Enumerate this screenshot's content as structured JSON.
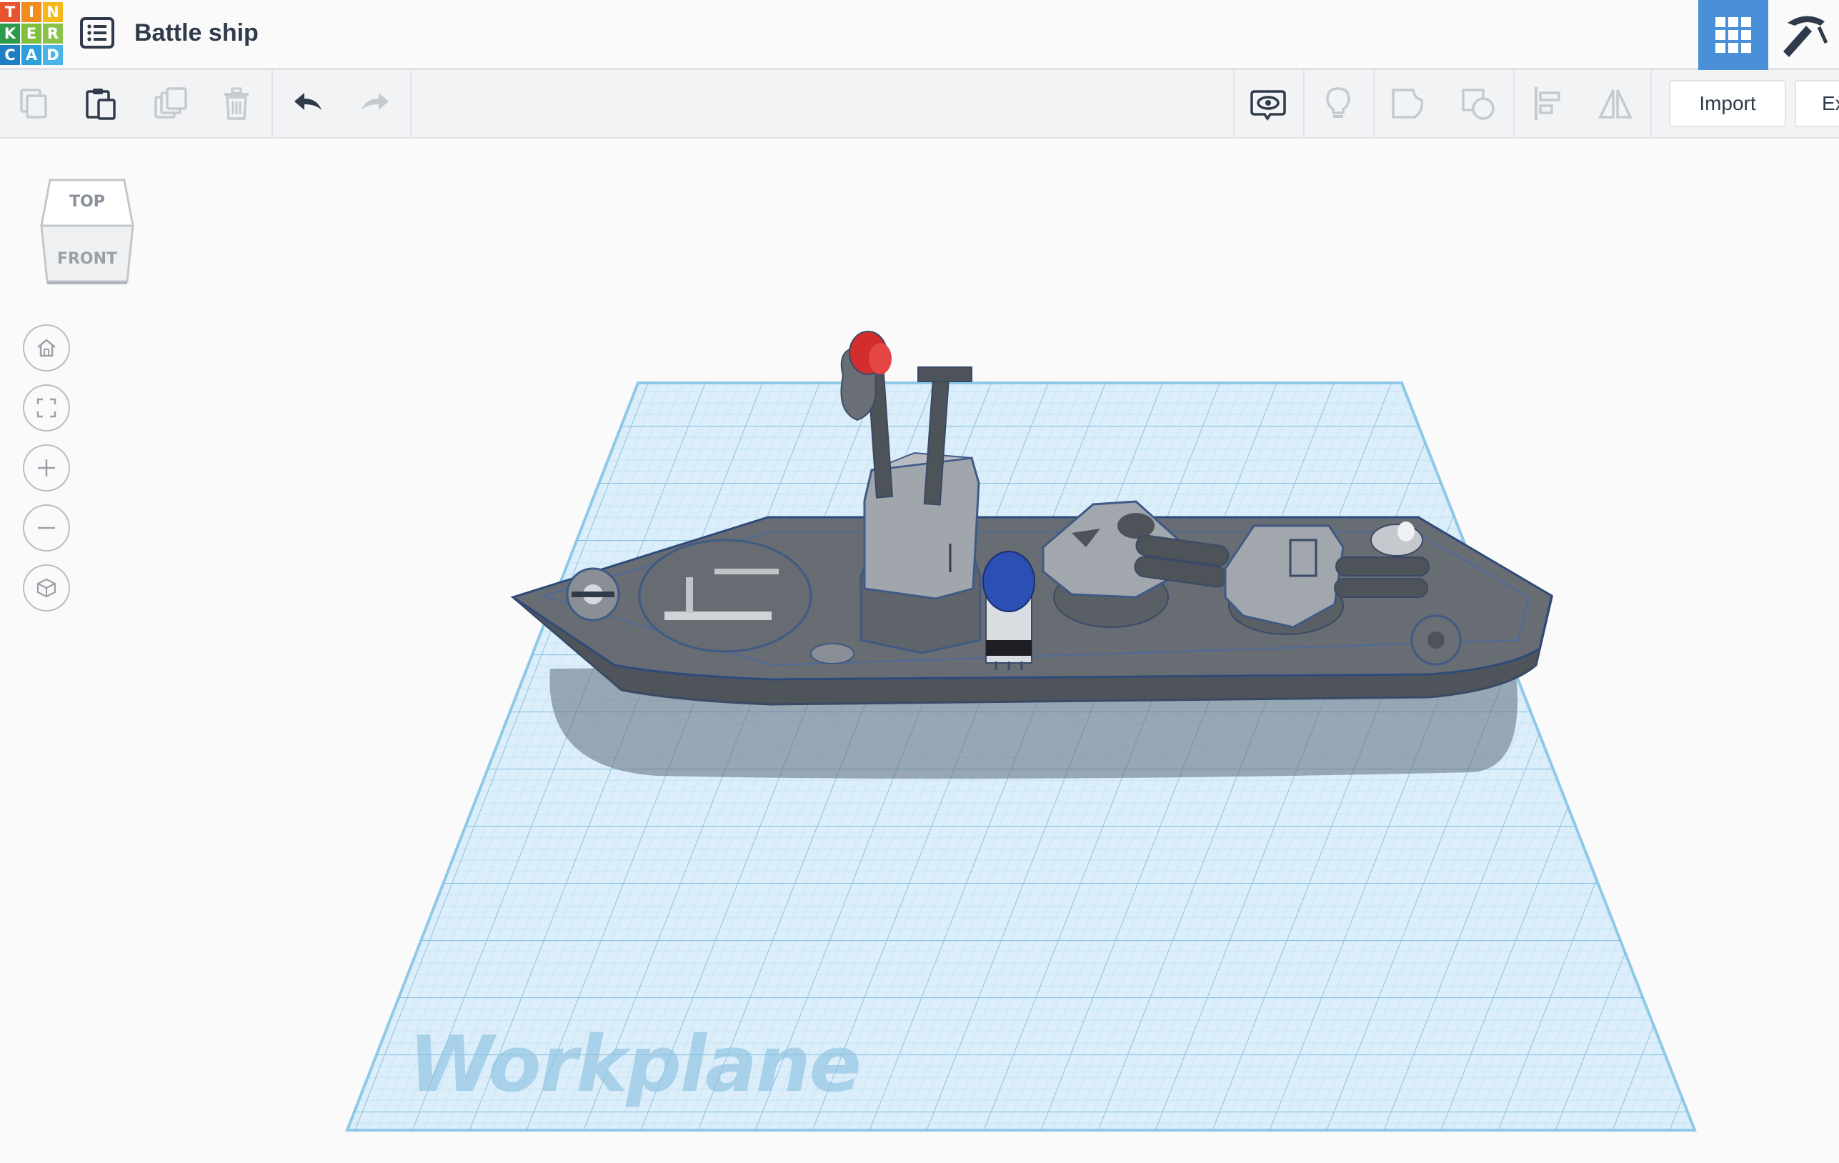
{
  "app": {
    "logo_letters": [
      "T",
      "I",
      "N",
      "K",
      "E",
      "R",
      "C",
      "A",
      "D"
    ],
    "logo_colors": [
      "#e8542e",
      "#f28c1e",
      "#f5b81b",
      "#2c9a4c",
      "#7fbf3b",
      "#8bc34a",
      "#1f7dc4",
      "#2aa0dc",
      "#4bb3e8"
    ]
  },
  "header": {
    "title": "Battle ship",
    "menu_icon": "list-icon",
    "view_icons": [
      "grid-view-icon",
      "pickaxe-icon"
    ]
  },
  "toolbar": {
    "left_tools": [
      {
        "icon": "copy-icon",
        "enabled": false
      },
      {
        "icon": "paste-icon",
        "enabled": true
      },
      {
        "icon": "duplicate-icon",
        "enabled": false
      },
      {
        "icon": "delete-icon",
        "enabled": false
      },
      {
        "icon": "undo-icon",
        "enabled": true
      },
      {
        "icon": "redo-icon",
        "enabled": false
      }
    ],
    "right_tools": [
      {
        "icon": "show-all-icon",
        "enabled": true
      },
      {
        "icon": "lightbulb-icon",
        "enabled": false
      },
      {
        "icon": "group-icon",
        "enabled": false
      },
      {
        "icon": "ungroup-icon",
        "enabled": false
      },
      {
        "icon": "align-icon",
        "enabled": false
      },
      {
        "icon": "mirror-icon",
        "enabled": false
      }
    ],
    "import_label": "Import",
    "export_label": "Ex"
  },
  "viewcube": {
    "top_label": "TOP",
    "front_label": "FRONT"
  },
  "nav_controls": [
    "home-icon",
    "fit-view-icon",
    "zoom-in-icon",
    "zoom-out-icon",
    "projection-icon"
  ],
  "workplane": {
    "label": "Workplane",
    "grid_color": "#8fc8e8",
    "plane_color": "#d8ecf7"
  },
  "colors": {
    "accent": "#4a90d9",
    "hull": "#5d6168",
    "deck": "#6e7279",
    "structure": "#9ea3aa",
    "red_part": "#e03030",
    "blue_part": "#2f4fb0"
  }
}
